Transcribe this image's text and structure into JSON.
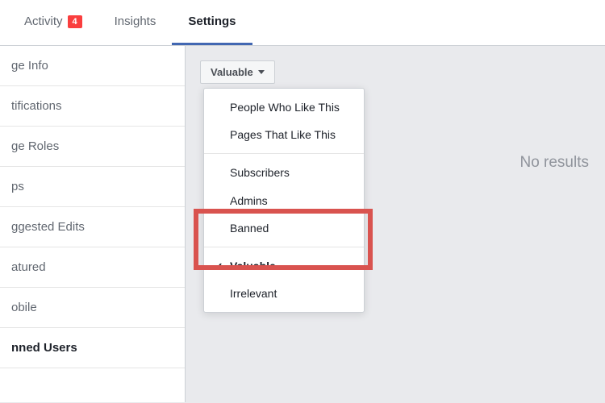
{
  "topNav": {
    "tabs": [
      {
        "label": "Activity",
        "badge": "4",
        "active": false
      },
      {
        "label": "Insights",
        "badge": null,
        "active": false
      },
      {
        "label": "Settings",
        "badge": null,
        "active": true
      }
    ]
  },
  "sidebar": {
    "items": [
      {
        "label": "ge Info",
        "selected": false
      },
      {
        "label": "tifications",
        "selected": false
      },
      {
        "label": "ge Roles",
        "selected": false
      },
      {
        "label": "ps",
        "selected": false
      },
      {
        "label": "ggested Edits",
        "selected": false
      },
      {
        "label": "atured",
        "selected": false
      },
      {
        "label": "obile",
        "selected": false
      },
      {
        "label": "nned Users",
        "selected": true
      }
    ]
  },
  "dropdown": {
    "buttonLabel": "Valuable",
    "group1": [
      "People Who Like This",
      "Pages That Like This"
    ],
    "group2": [
      "Subscribers",
      "Admins",
      "Banned"
    ],
    "group3": [
      {
        "label": "Valuable",
        "checked": true
      },
      {
        "label": "Irrelevant",
        "checked": false
      }
    ]
  },
  "main": {
    "noResults": "No results"
  }
}
